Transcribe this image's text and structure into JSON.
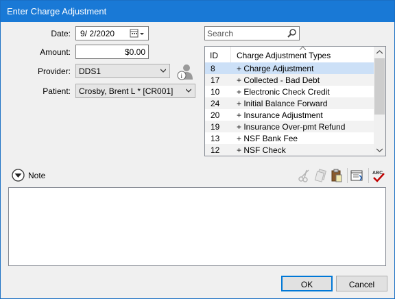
{
  "window": {
    "title": "Enter Charge Adjustment"
  },
  "form": {
    "date_label": "Date:",
    "date_value": "9/  2/2020",
    "amount_label": "Amount:",
    "amount_value": "$0.00",
    "provider_label": "Provider:",
    "provider_value": "DDS1",
    "patient_label": "Patient:",
    "patient_value": "Crosby, Brent L *  [CR001]"
  },
  "search": {
    "placeholder": "Search"
  },
  "table": {
    "columns": [
      "ID",
      "Charge Adjustment Types"
    ],
    "rows": [
      {
        "id": "8",
        "name": "+ Charge Adjustment"
      },
      {
        "id": "17",
        "name": "+ Collected - Bad Debt"
      },
      {
        "id": "10",
        "name": "+ Electronic Check Credit"
      },
      {
        "id": "24",
        "name": "+ Initial Balance Forward"
      },
      {
        "id": "20",
        "name": "+ Insurance Adjustment"
      },
      {
        "id": "19",
        "name": "+ Insurance Over-pmt Refund"
      },
      {
        "id": "13",
        "name": "+ NSF Bank Fee"
      },
      {
        "id": "12",
        "name": "+ NSF Check"
      }
    ]
  },
  "note": {
    "label": "Note"
  },
  "buttons": {
    "ok": "OK",
    "cancel": "Cancel"
  },
  "colors": {
    "titlebar": "#1979d6",
    "selected_row": "#cce0f7",
    "spell_check_red": "#c00000"
  }
}
